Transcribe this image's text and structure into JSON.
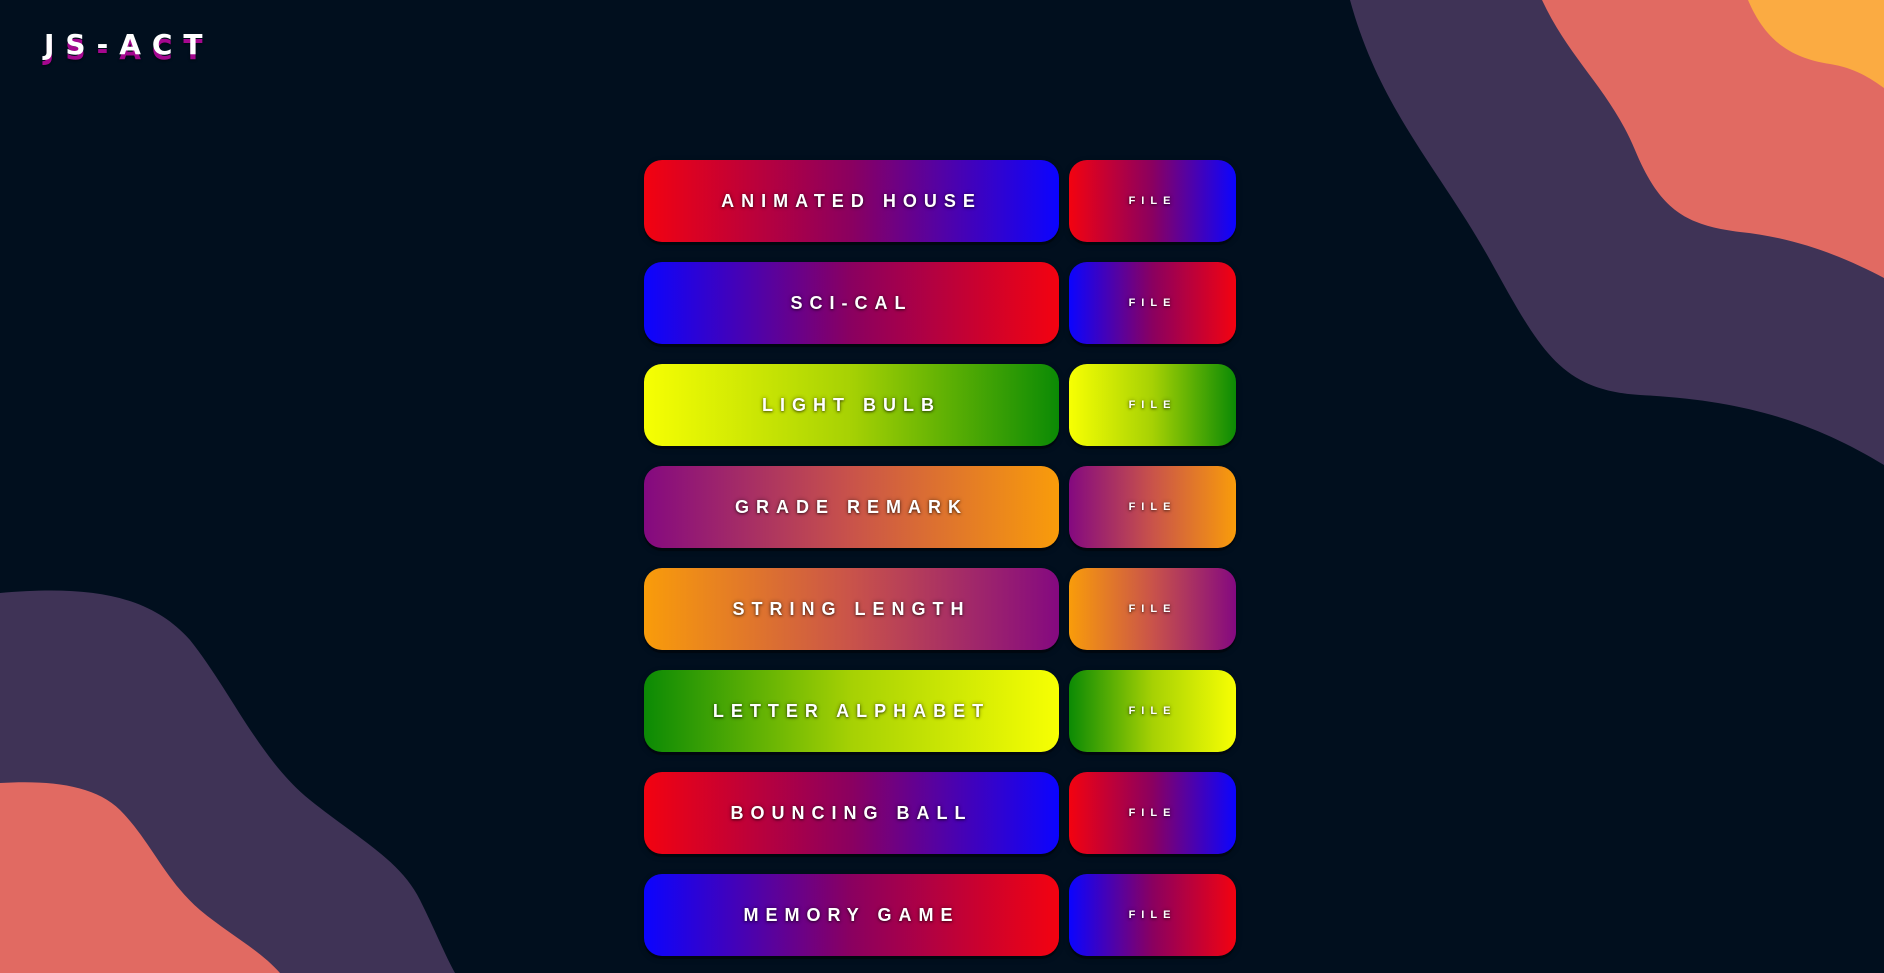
{
  "brand": {
    "logo_text": "JS-ACT"
  },
  "colors": {
    "background": "#010f1e",
    "blob_purple": "#3f3356",
    "blob_coral": "#e16a62",
    "blob_orange": "#fbab42",
    "logo_shadow": "#a5078f"
  },
  "projects": [
    {
      "title": "ANIMATED HOUSE",
      "file_label": "FILE",
      "gradient": [
        "#f30210",
        "#0b04ff"
      ]
    },
    {
      "title": "SCI-CAL",
      "file_label": "FILE",
      "gradient": [
        "#0b04ff",
        "#f30210"
      ]
    },
    {
      "title": "LIGHT BULB",
      "file_label": "FILE",
      "gradient": [
        "#f7ff03",
        "#0b8a05"
      ]
    },
    {
      "title": "GRADE REMARK",
      "file_label": "FILE",
      "gradient": [
        "#840980",
        "#f99c0a"
      ]
    },
    {
      "title": "STRING LENGTH",
      "file_label": "FILE",
      "gradient": [
        "#f99c0a",
        "#840980"
      ]
    },
    {
      "title": "LETTER ALPHABET",
      "file_label": "FILE",
      "gradient": [
        "#0b8a05",
        "#f7ff03"
      ]
    },
    {
      "title": "BOUNCING BALL",
      "file_label": "FILE",
      "gradient": [
        "#f30210",
        "#0b04ff"
      ]
    },
    {
      "title": "MEMORY GAME",
      "file_label": "FILE",
      "gradient": [
        "#0b04ff",
        "#f30210"
      ]
    }
  ]
}
